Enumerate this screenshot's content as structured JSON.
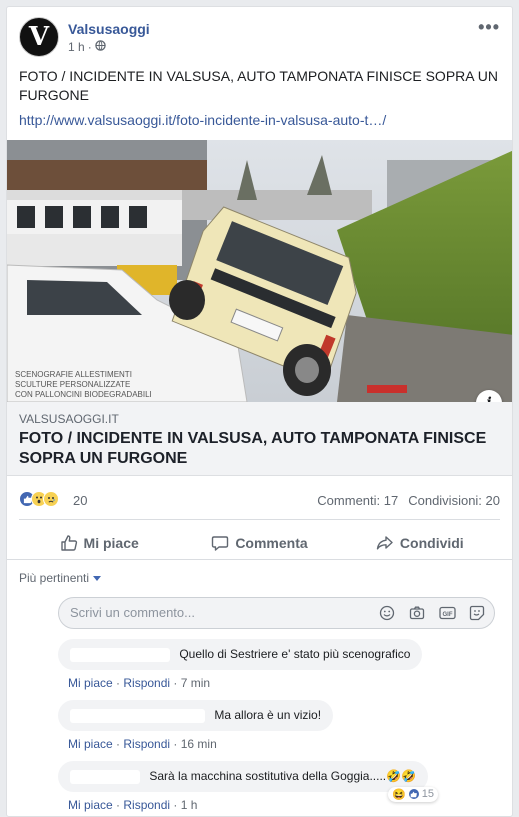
{
  "post": {
    "page_name": "Valsusaoggi",
    "avatar_letter": "V",
    "time": "1 h",
    "dot": "·",
    "text": "FOTO / INCIDENTE IN VALSUSA, AUTO TAMPONATA FINISCE SOPRA UN FURGONE",
    "link": "http://www.valsusaoggi.it/foto-incidente-in-valsusa-auto-t…/"
  },
  "image": {
    "van_text_1": "SCENOGRAFIE ALLESTIMENTI",
    "van_text_2": "SCULTURE PERSONALIZZATE",
    "van_text_3": "CON PALLONCINI BIODEGRADABILI",
    "info_icon": "i"
  },
  "preview": {
    "domain": "VALSUSAOGGI.IT",
    "title": "FOTO / INCIDENTE IN VALSUSA, AUTO TAMPONATA FINISCE SOPRA UN FURGONE"
  },
  "stats": {
    "reactions": "20",
    "comments": "Commenti: 17",
    "shares": "Condivisioni: 20",
    "icons": [
      "like-reaction-icon",
      "wow-reaction-icon",
      "sad-reaction-icon"
    ]
  },
  "actions": {
    "like": "Mi piace",
    "comment": "Commenta",
    "share": "Condividi"
  },
  "comments_section": {
    "filter": "Più pertinenti",
    "placeholder": "Scrivi un commento...",
    "items": [
      {
        "text": "Quello di Sestriere e' stato più scenografico",
        "like": "Mi piace",
        "reply": "Rispondi",
        "time": "7 min"
      },
      {
        "text": "Ma allora è un vizio!",
        "like": "Mi piace",
        "reply": "Rispondi",
        "time": "16 min"
      },
      {
        "text": "Sarà la macchina sostitutiva della Goggia.....🤣🤣",
        "like": "Mi piace",
        "reply": "Rispondi",
        "time": "1 h",
        "reaction_count": "15"
      }
    ]
  },
  "colors": {
    "link": "#385898",
    "accent": "#4267b2",
    "muted": "#606770"
  }
}
